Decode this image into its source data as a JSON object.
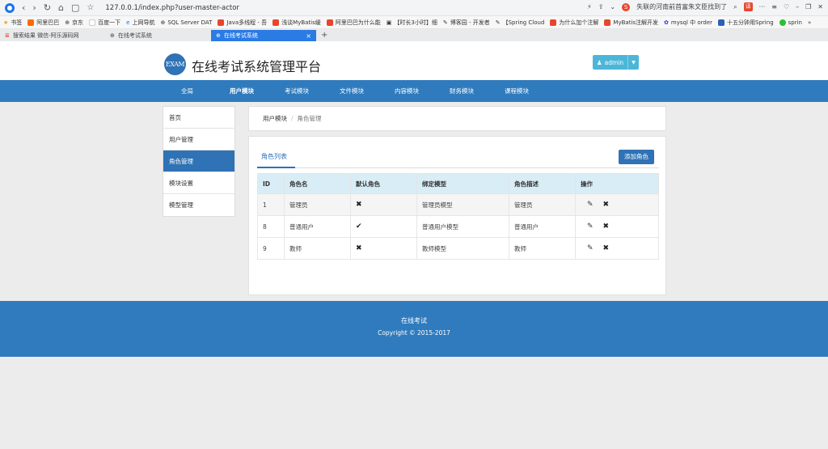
{
  "browser": {
    "url": "127.0.0.1/index.php?user-master-actor",
    "hot_news": "失联的河南前首富朱文臣找到了",
    "bookmarks": [
      "书签",
      "阿里巴巴",
      "京东",
      "百度一下",
      "上网导航",
      "SQL Server DAT",
      "Java多线程 - 吾",
      "浅谈MyBatis缓",
      "阿里巴巴为什么能",
      "【时长3小时】细",
      "博客园 - 开发者",
      "【Spring Cloud",
      "为什么加个注解",
      "MyBatis注解开发",
      "mysql 中 order",
      "十五分钟用Spring",
      "sprin"
    ],
    "tabs": [
      {
        "label": "搜索结果 微信-阿乐源码网"
      },
      {
        "label": "在线考试系统"
      },
      {
        "label": "在线考试系统",
        "active": true
      }
    ],
    "new_tab": "+",
    "accent": "#2b7be4"
  },
  "header": {
    "logo_text": "EXAM",
    "title": "在线考试系统管理平台",
    "user_label": "admin"
  },
  "nav": [
    "全局",
    "用户模块",
    "考试模块",
    "文件模块",
    "内容模块",
    "财务模块",
    "课程模块"
  ],
  "nav_active": "用户模块",
  "sidebar": [
    "首页",
    "用户管理",
    "角色管理",
    "模块设置",
    "模型管理"
  ],
  "sidebar_active": "角色管理",
  "breadcrumb": {
    "parent": "用户模块",
    "current": "角色管理"
  },
  "content": {
    "tab_label": "角色列表",
    "add_button": "添加角色",
    "columns": [
      "ID",
      "角色名",
      "默认角色",
      "绑定模型",
      "角色描述",
      "操作"
    ],
    "rows": [
      {
        "id": "1",
        "name": "管理员",
        "default": false,
        "model": "管理员模型",
        "desc": "管理员"
      },
      {
        "id": "8",
        "name": "普通用户",
        "default": true,
        "model": "普通用户模型",
        "desc": "普通用户"
      },
      {
        "id": "9",
        "name": "教师",
        "default": false,
        "model": "教师模型",
        "desc": "教师"
      }
    ]
  },
  "footer": {
    "line1": "在线考试",
    "line2": "Copyright © 2015-2017"
  },
  "colors": {
    "primary": "#2f7bbd",
    "table_header": "#d9edf7",
    "user_button": "#4db6d8"
  }
}
